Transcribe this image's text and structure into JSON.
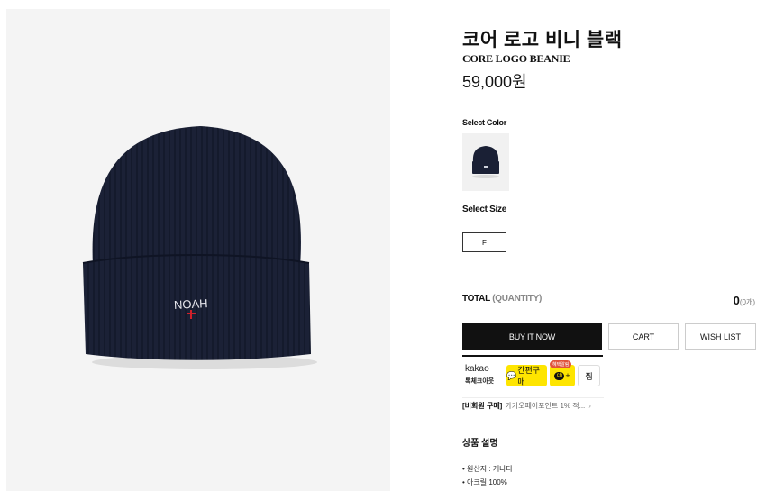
{
  "product": {
    "title_ko": "코어 로고 비니 블랙",
    "title_en": "CORE LOGO BEANIE",
    "price": "59,000원",
    "hat_logo": "NOAH"
  },
  "options": {
    "color_label": "Select Color",
    "size_label": "Select Size",
    "size_value": "F"
  },
  "total": {
    "label": "TOTAL",
    "qty_label": "(QUANTITY)",
    "value": "0",
    "count": "(0개)"
  },
  "buttons": {
    "buy_now": "BUY IT NOW",
    "cart": "CART",
    "wish_list": "WISH LIST"
  },
  "kakao": {
    "brand": "kakao",
    "sub": "톡체크아웃",
    "quick_buy": "간편구매",
    "badge": "혜택알림",
    "plus": "+",
    "zzim": "찜"
  },
  "promo": {
    "tag": "[비회원 구매]",
    "text": "카카오페이포인트 1% 적..."
  },
  "description": {
    "title": "상품 설명",
    "items": [
      "원산지 : 캐나다",
      "아크릴 100%"
    ]
  },
  "colors": {
    "beanie": "#1a2035",
    "kakao_yellow": "#fee500",
    "badge_red": "#e0533b"
  }
}
